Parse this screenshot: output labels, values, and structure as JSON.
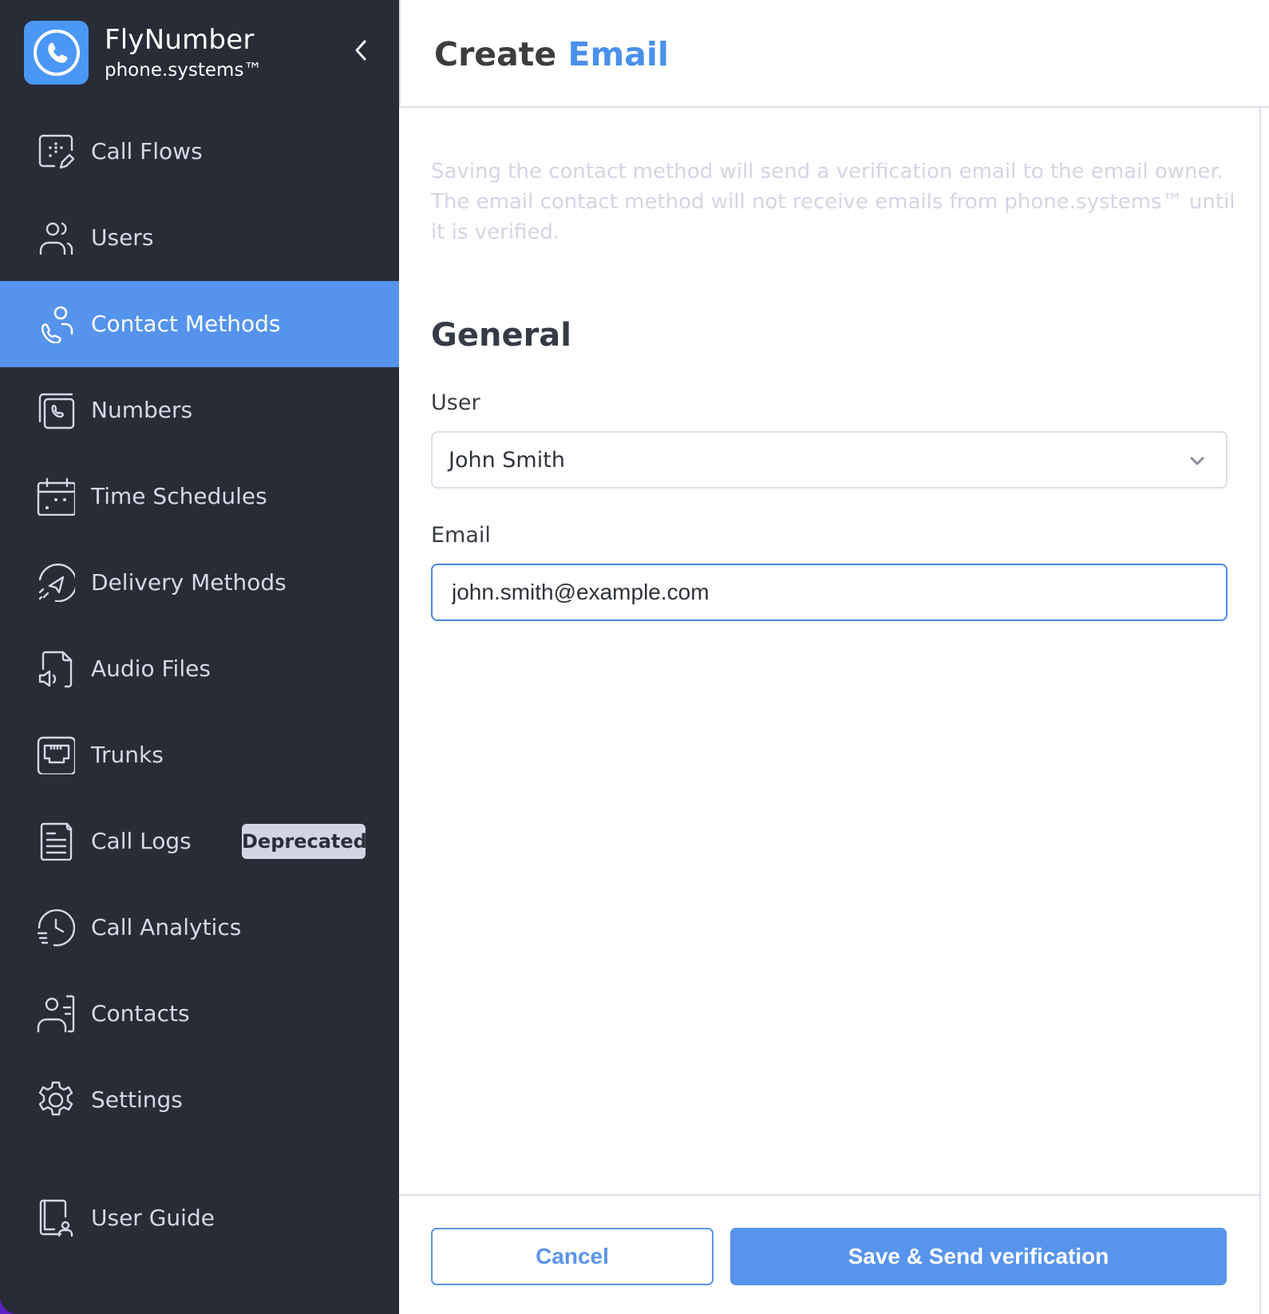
{
  "brand": {
    "name": "FlyNumber",
    "subtitle": "phone.systems™",
    "logo_icon": "phone-circle-icon",
    "logo_color": "#4a97f5"
  },
  "sidebar": {
    "collapse_icon": "chevron-left-icon",
    "active_color": "#5593ec",
    "items": [
      {
        "label": "Call Flows",
        "icon": "call-flows-icon",
        "active": false
      },
      {
        "label": "Users",
        "icon": "users-icon",
        "active": false
      },
      {
        "label": "Contact Methods",
        "icon": "contact-methods-icon",
        "active": true
      },
      {
        "label": "Numbers",
        "icon": "numbers-icon",
        "active": false
      },
      {
        "label": "Time Schedules",
        "icon": "calendar-icon",
        "active": false
      },
      {
        "label": "Delivery Methods",
        "icon": "delivery-icon",
        "active": false
      },
      {
        "label": "Audio Files",
        "icon": "audio-file-icon",
        "active": false
      },
      {
        "label": "Trunks",
        "icon": "trunk-icon",
        "active": false
      },
      {
        "label": "Call Logs",
        "icon": "document-icon",
        "active": false,
        "badge": "Deprecated"
      },
      {
        "label": "Call Analytics",
        "icon": "history-icon",
        "active": false
      },
      {
        "label": "Contacts",
        "icon": "contacts-icon",
        "active": false
      },
      {
        "label": "Settings",
        "icon": "gear-icon",
        "active": false
      }
    ],
    "footer_item": {
      "label": "User Guide",
      "icon": "user-guide-icon"
    }
  },
  "header": {
    "title_prefix": "Create",
    "title_accent": "Email",
    "accent_color": "#4a90ec"
  },
  "form": {
    "notice": "Saving the contact method will send a verification email to the email owner. The email contact method will not receive emails from phone.systems™ until it is verified.",
    "section_title": "General",
    "user": {
      "label": "User",
      "value": "John Smith"
    },
    "email": {
      "label": "Email",
      "value": "john.smith@example.com"
    }
  },
  "footer": {
    "cancel_label": "Cancel",
    "save_label": "Save & Send verification"
  }
}
